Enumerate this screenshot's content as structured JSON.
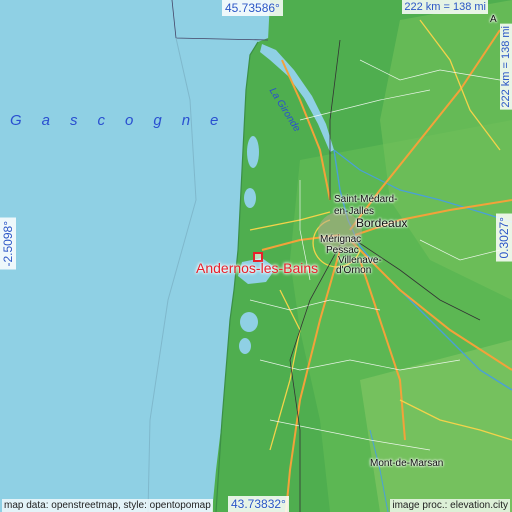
{
  "coords": {
    "top": "45.73586°",
    "bottom": "43.73832°",
    "left": "-2.5098°",
    "right": "0.3027°"
  },
  "scale": {
    "horizontal": "222 km = 138 mi",
    "vertical": "222 km = 138 mi"
  },
  "labels": {
    "sea": "Gascogne",
    "river": "La Gironde"
  },
  "highlight_city": "Andernos-les-Bains",
  "cities": {
    "saint_medard_line1": "Saint-Médard-",
    "saint_medard_line2": "en-Jalles",
    "bordeaux": "Bordeaux",
    "merignac": "Mérignac",
    "pessac": "Pessac",
    "villenave_line1": "Villenave-",
    "villenave_line2": "d'Ornon",
    "mont_de_marsan": "Mont-de-Marsan",
    "top_right": "A"
  },
  "credits": {
    "left": "map data: openstreetmap, style: opentopomap",
    "right": "image proc.: elevation.city"
  },
  "colors": {
    "sea": "#8fd0e4",
    "land": "#4fae4f",
    "highlight": "#e8202a",
    "coords": "#2a56c6"
  }
}
